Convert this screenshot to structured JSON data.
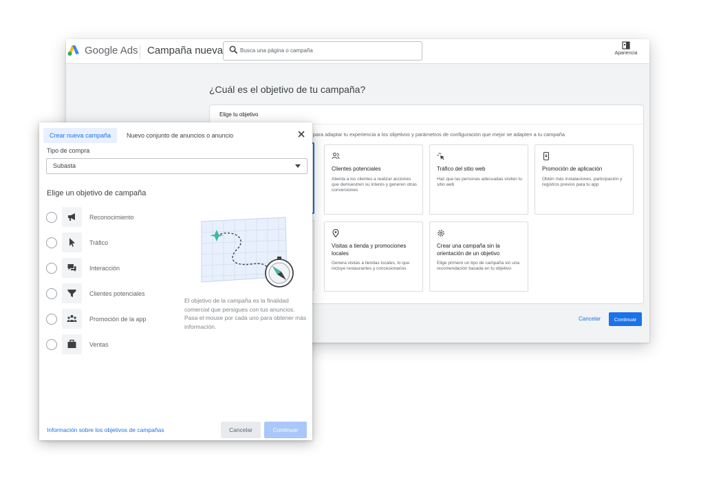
{
  "header": {
    "brand": "Google Ads",
    "page_title": "Campaña nueva",
    "search_placeholder": "Busca una página o campaña",
    "appearance_label": "Apariencia"
  },
  "main": {
    "question": "¿Cuál es el objetivo de tu campaña?",
    "card_title": "Elige tu objetivo",
    "card_description": "para adaptar tu experiencia a los objetivos y parámetros de configuración que mejor se adapten a tu campaña",
    "tiles": [
      {
        "title": "Clientes potenciales",
        "description": "Alienta a los clientes a realizar acciones que demuestren su interés y generen otras conversiones",
        "icon": "people-icon"
      },
      {
        "title": "Tráfico del sitio web",
        "description": "Haz que las personas adecuadas visiten tu sitio web",
        "icon": "cursor-click-icon"
      },
      {
        "title": "Promoción de aplicación",
        "description": "Obtén más instalaciones, participación y registros previos para tu app",
        "icon": "phone-icon"
      },
      {
        "title": "Visitas a tienda y promociones locales",
        "description": "Genera visitas a tiendas locales, lo que incluye restaurantes y concesionarios",
        "icon": "location-pin-icon"
      },
      {
        "title": "Crear una campaña sin la orientación de un objetivo",
        "description": "Elige primero un tipo de campaña sin una recomendación basada en tu objetivo",
        "icon": "gear-icon"
      }
    ],
    "cancel_label": "Cancelar",
    "continue_label": "Continuar"
  },
  "dialog": {
    "tab_active": "Crear nueva campaña",
    "tab_inactive": "Nuevo conjunto de anuncios o anuncio",
    "purchase_type_label": "Tipo de compra",
    "purchase_type_value": "Subasta",
    "section_title": "Elige un objetivo de campaña",
    "options": [
      {
        "label": "Reconocimiento",
        "icon": "megaphone-icon"
      },
      {
        "label": "Tráfico",
        "icon": "cursor-icon"
      },
      {
        "label": "Interacción",
        "icon": "chat-icon"
      },
      {
        "label": "Clientes potenciales",
        "icon": "funnel-icon"
      },
      {
        "label": "Promoción de la app",
        "icon": "group-icon"
      },
      {
        "label": "Ventas",
        "icon": "briefcase-icon"
      }
    ],
    "help_text": "El objetivo de la campaña es la finalidad comercial que persigues con tus anuncios. Pasa el mouse por cada uno para obtener más información.",
    "info_link": "Información sobre los objetivos de campañas",
    "cancel_label": "Cancelar",
    "continue_label": "Continuar"
  },
  "colors": {
    "accent": "#1a73e8",
    "accent_disabled": "#a8c7fa",
    "teal_marker": "#3fb9a1"
  }
}
